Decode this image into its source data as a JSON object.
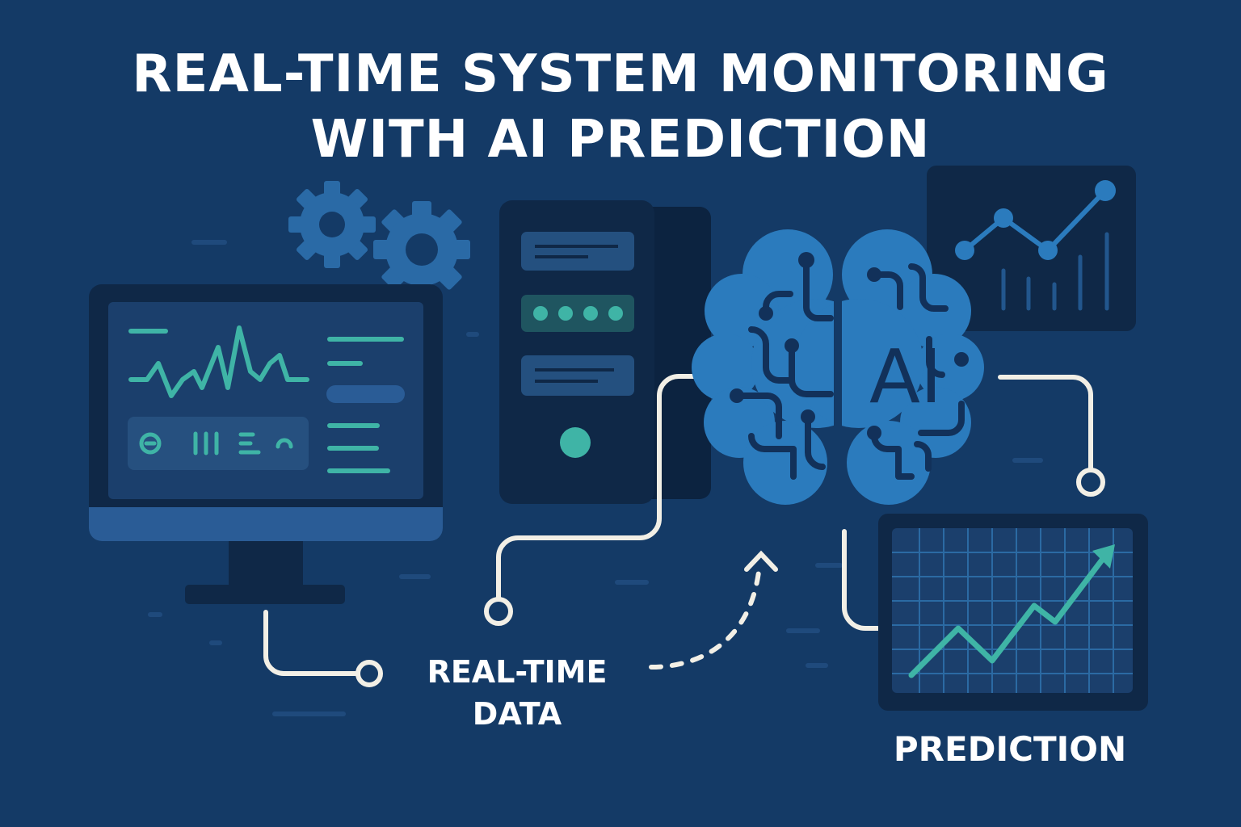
{
  "title": {
    "line1": "REAL-TIME SYSTEM MONITORING",
    "line2": "WITH AI PREDICTION"
  },
  "labels": {
    "realtime_data": [
      "REAL-TIME",
      "DATA"
    ],
    "prediction": "PREDICTION",
    "brain_text": "AI"
  },
  "icons": [
    "gear-icon",
    "gear-icon",
    "monitor-icon",
    "server-icon",
    "ai-brain-icon",
    "trend-chart-icon",
    "prediction-chart-icon",
    "arrow-icon"
  ],
  "colors": {
    "background": "#143a66",
    "teal_accent": "#3fb4a6",
    "brain_blue": "#2b7bbd",
    "connector": "#f2efe6",
    "dark_panel": "#0f2847"
  }
}
